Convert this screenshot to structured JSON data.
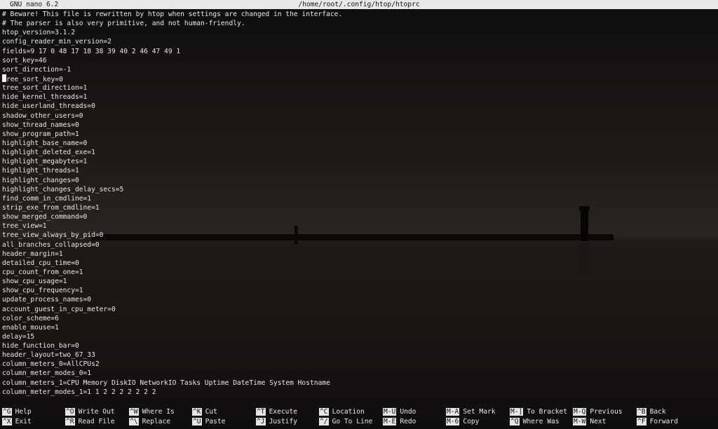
{
  "titlebar": {
    "app_name": "GNU nano 6.2",
    "file_path": "/home/root/.config/htop/htoprc"
  },
  "editor": {
    "lines": [
      "# Beware! This file is rewritten by htop when settings are changed in the interface.",
      "# The parser is also very primitive, and not human-friendly.",
      "htop_version=3.1.2",
      "config_reader_min_version=2",
      "fields=9 17 0 48 17 18 38 39 40 2 46 47 49 1",
      "sort_key=46",
      "sort_direction=-1",
      "tree_sort_key=0",
      "tree_sort_direction=1",
      "hide_kernel_threads=1",
      "hide_userland_threads=0",
      "shadow_other_users=0",
      "show_thread_names=0",
      "show_program_path=1",
      "highlight_base_name=0",
      "highlight_deleted_exe=1",
      "highlight_megabytes=1",
      "highlight_threads=1",
      "highlight_changes=0",
      "highlight_changes_delay_secs=5",
      "find_comm_in_cmdline=1",
      "strip_exe_from_cmdline=1",
      "show_merged_command=0",
      "tree_view=1",
      "tree_view_always_by_pid=0",
      "all_branches_collapsed=0",
      "header_margin=1",
      "detailed_cpu_time=0",
      "cpu_count_from_one=1",
      "show_cpu_usage=1",
      "show_cpu_frequency=1",
      "update_process_names=0",
      "account_guest_in_cpu_meter=0",
      "color_scheme=6",
      "enable_mouse=1",
      "delay=15",
      "hide_function_bar=0",
      "header_layout=two_67_33",
      "column_meters_0=AllCPUs2",
      "column_meter_modes_0=1",
      "column_meters_1=CPU Memory DiskIO NetworkIO Tasks Uptime DateTime System Hostname",
      "column_meter_modes_1=1 1 2 2 2 2 2 2 2"
    ],
    "cursor_line": 7
  },
  "shortcuts": {
    "row1": [
      {
        "key": "^G",
        "label": "Help"
      },
      {
        "key": "^O",
        "label": "Write Out"
      },
      {
        "key": "^W",
        "label": "Where Is"
      },
      {
        "key": "^K",
        "label": "Cut"
      },
      {
        "key": "^T",
        "label": "Execute"
      },
      {
        "key": "^C",
        "label": "Location"
      },
      {
        "key": "M-U",
        "label": "Undo"
      },
      {
        "key": "M-A",
        "label": "Set Mark"
      },
      {
        "key": "M-]",
        "label": "To Bracket"
      },
      {
        "key": "M-Q",
        "label": "Previous"
      },
      {
        "key": "^B",
        "label": "Back"
      }
    ],
    "row2": [
      {
        "key": "^X",
        "label": "Exit"
      },
      {
        "key": "^R",
        "label": "Read File"
      },
      {
        "key": "^\\",
        "label": "Replace"
      },
      {
        "key": "^U",
        "label": "Paste"
      },
      {
        "key": "^J",
        "label": "Justify"
      },
      {
        "key": "^/",
        "label": "Go To Line"
      },
      {
        "key": "M-E",
        "label": "Redo"
      },
      {
        "key": "M-6",
        "label": "Copy"
      },
      {
        "key": "^Q",
        "label": "Where Was"
      },
      {
        "key": "M-W",
        "label": "Next"
      },
      {
        "key": "^F",
        "label": "Forward"
      }
    ]
  }
}
